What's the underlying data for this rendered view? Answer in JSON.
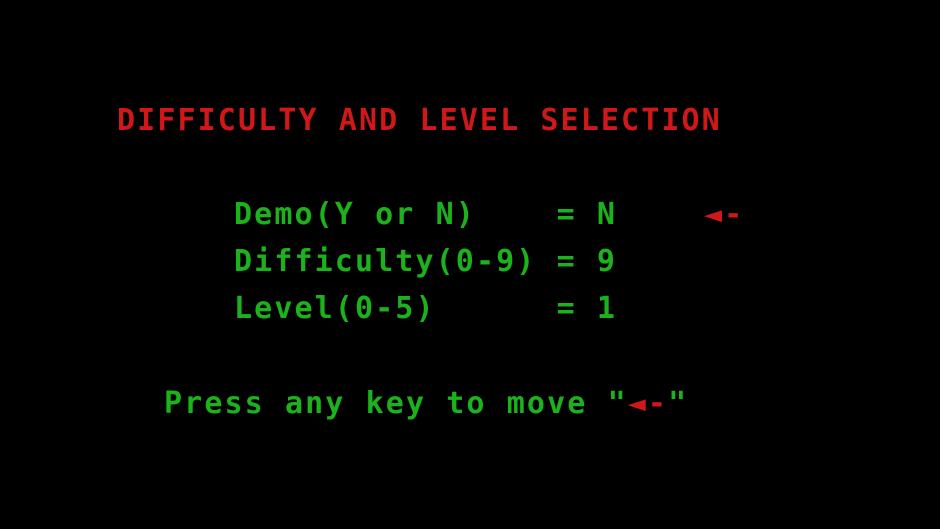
{
  "title": "DIFFICULTY AND LEVEL SELECTION",
  "options": [
    {
      "label": "Demo(Y or N)    ",
      "eq": "= ",
      "value": "N"
    },
    {
      "label": "Difficulty(0-9) ",
      "eq": "= ",
      "value": "9"
    },
    {
      "label": "Level(0-5)      ",
      "eq": "= ",
      "value": "1"
    }
  ],
  "cursor": "◄-",
  "prompt": {
    "text": "Press any key to move ",
    "quote_open": "\"",
    "arrow": "◄-",
    "quote_close": "\""
  },
  "colors": {
    "background": "#000000",
    "title": "#d01818",
    "text": "#1bb21b",
    "arrow": "#d01818"
  }
}
